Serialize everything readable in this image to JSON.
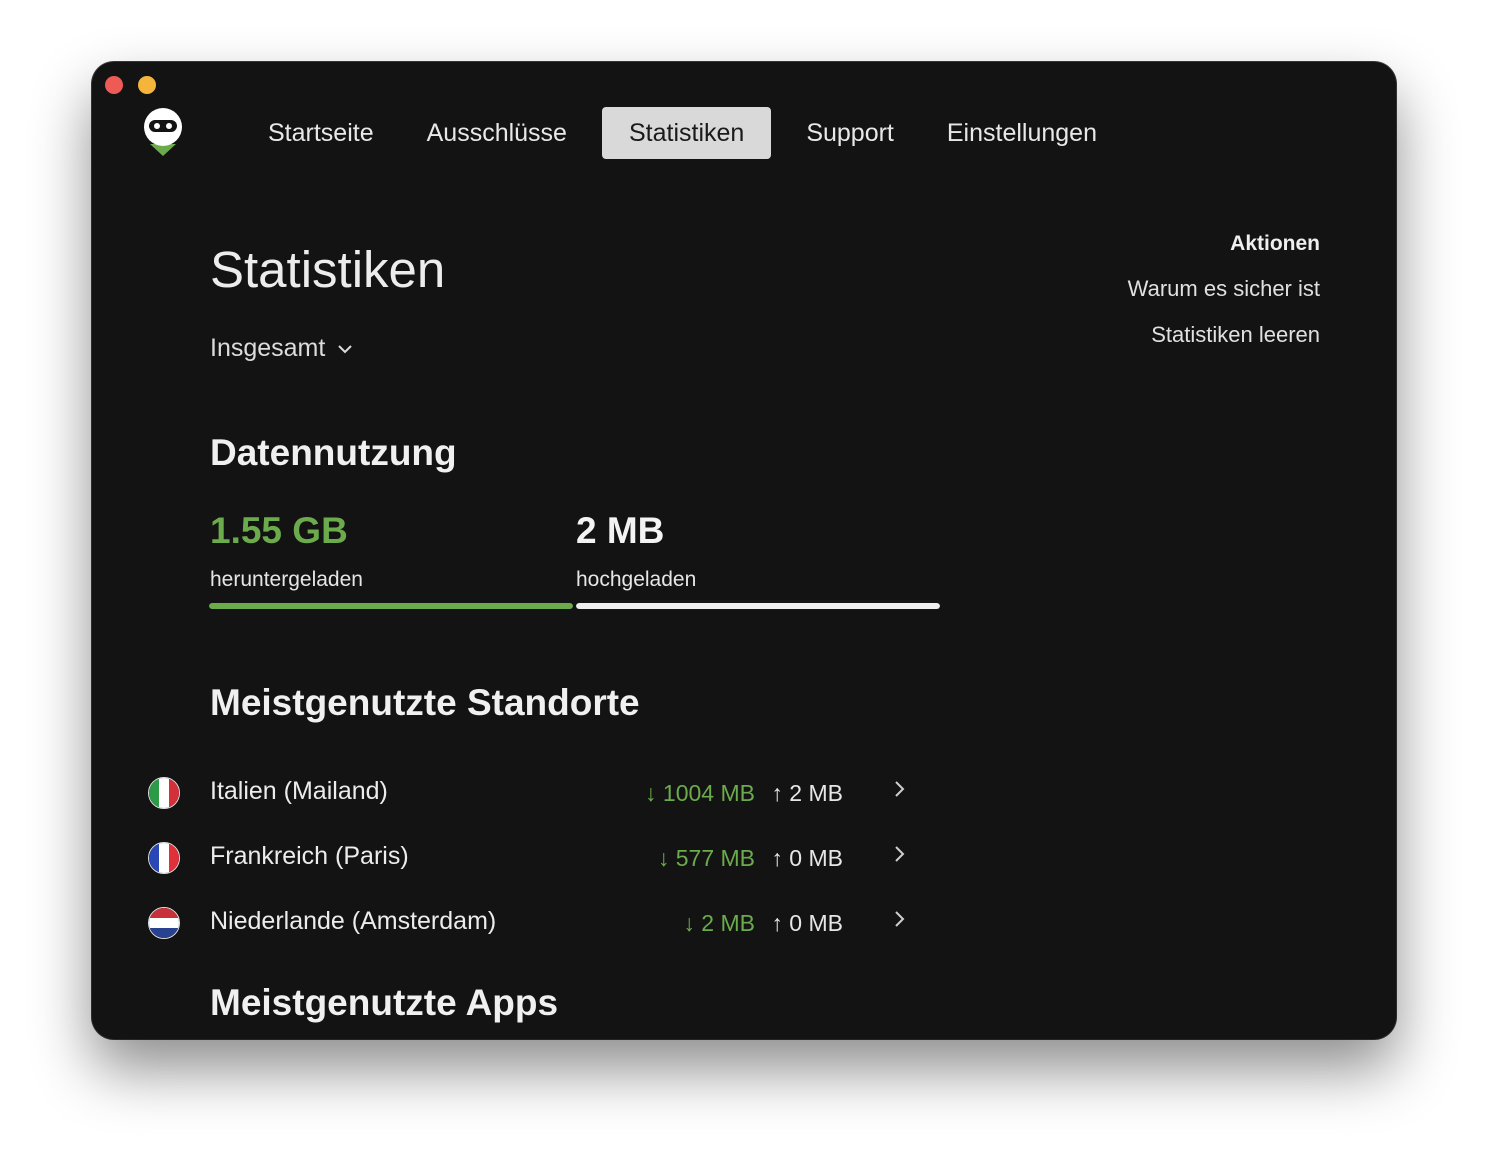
{
  "nav": {
    "tabs": [
      {
        "label": "Startseite",
        "active": false
      },
      {
        "label": "Ausschlüsse",
        "active": false
      },
      {
        "label": "Statistiken",
        "active": true
      },
      {
        "label": "Support",
        "active": false
      },
      {
        "label": "Einstellungen",
        "active": false
      }
    ]
  },
  "page": {
    "title": "Statistiken",
    "period": "Insgesamt"
  },
  "actions": {
    "heading": "Aktionen",
    "items": [
      "Warum es sicher ist",
      "Statistiken leeren"
    ]
  },
  "data_usage": {
    "title": "Datennutzung",
    "download": {
      "value": "1.55 GB",
      "label": "heruntergeladen",
      "bar_fill_percent": 100
    },
    "upload": {
      "value": "2 MB",
      "label": "hochgeladen",
      "bar_fill_percent": 100
    }
  },
  "locations": {
    "title": "Meistgenutzte Standorte",
    "items": [
      {
        "flag": "flag-italy-icon",
        "name": "Italien (Mailand)",
        "down": "↓ 1004 MB",
        "up": "↑ 2 MB"
      },
      {
        "flag": "flag-france-icon",
        "name": "Frankreich (Paris)",
        "down": "↓ 577 MB",
        "up": "↑ 0 MB"
      },
      {
        "flag": "flag-netherlands-icon",
        "name": "Niederlande (Amsterdam)",
        "down": "↓ 2 MB",
        "up": "↑ 0 MB"
      }
    ]
  },
  "apps": {
    "title": "Meistgenutzte Apps"
  },
  "colors": {
    "accent_green": "#6bab4c",
    "window_bg": "#131313",
    "active_tab_bg": "#d9d9d9",
    "upload_bar": "#eeeeee"
  }
}
